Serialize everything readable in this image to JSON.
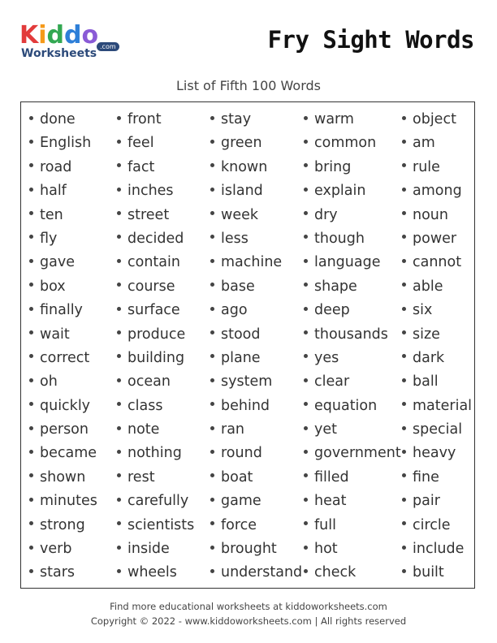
{
  "brand": {
    "name_letters": [
      {
        "ch": "K",
        "color": "#e23b3b"
      },
      {
        "ch": "i",
        "color": "#f59a1a"
      },
      {
        "ch": "d",
        "color": "#33a852"
      },
      {
        "ch": "d",
        "color": "#2e7fd8"
      },
      {
        "ch": "o",
        "color": "#8a5bd6"
      }
    ],
    "subtitle": "Worksheets",
    "suffix": ".com"
  },
  "header": {
    "title": "Fry Sight Words",
    "subtitle": "List of Fifth 100 Words"
  },
  "columns": [
    [
      "done",
      "English",
      "road",
      "half",
      "ten",
      "fly",
      "gave",
      "box",
      "finally",
      "wait",
      "correct",
      "oh",
      "quickly",
      "person",
      "became",
      "shown",
      "minutes",
      "strong",
      "verb",
      "stars"
    ],
    [
      "front",
      "feel",
      "fact",
      "inches",
      "street",
      "decided",
      "contain",
      "course",
      "surface",
      "produce",
      "building",
      "ocean",
      "class",
      "note",
      "nothing",
      "rest",
      "carefully",
      "scientists",
      "inside",
      "wheels"
    ],
    [
      "stay",
      "green",
      "known",
      "island",
      "week",
      "less",
      "machine",
      "base",
      "ago",
      "stood",
      "plane",
      "system",
      "behind",
      "ran",
      "round",
      "boat",
      "game",
      "force",
      "brought",
      "understand"
    ],
    [
      "warm",
      "common",
      "bring",
      "explain",
      "dry",
      "though",
      "language",
      "shape",
      "deep",
      "thousands",
      "yes",
      "clear",
      "equation",
      "yet",
      "government",
      "filled",
      "heat",
      "full",
      "hot",
      "check"
    ],
    [
      "object",
      "am",
      "rule",
      "among",
      "noun",
      "power",
      "cannot",
      "able",
      "six",
      "size",
      "dark",
      "ball",
      "material",
      "special",
      "heavy",
      "fine",
      "pair",
      "circle",
      "include",
      "built"
    ]
  ],
  "footer": {
    "line1": "Find more educational worksheets at kiddoworksheets.com",
    "line2": "Copyright © 2022 - www.kiddoworksheets.com  |  All rights reserved"
  }
}
